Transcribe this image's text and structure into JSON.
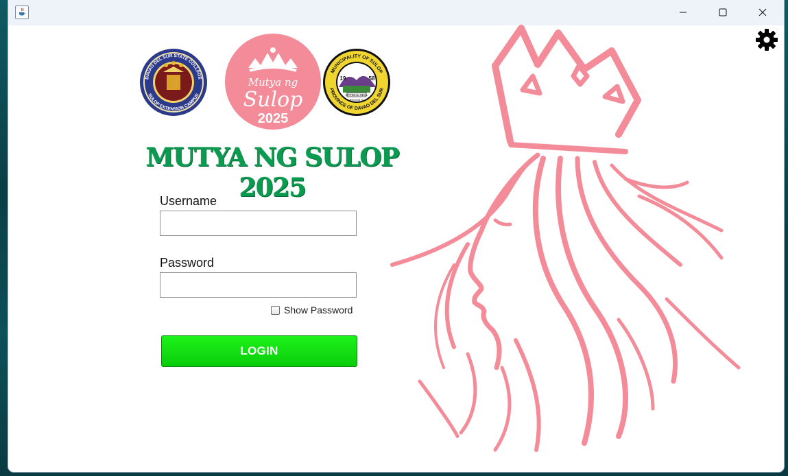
{
  "window": {
    "controls": {
      "minimize_icon": "minimize-icon",
      "maximize_icon": "maximize-icon",
      "close_icon": "close-icon"
    }
  },
  "settings": {
    "icon": "gear-icon"
  },
  "logos": {
    "left_seal": {
      "text_top": "DAVAO DEL SUR STATE COLLEGE",
      "text_bottom": "SULOP EXTENSION CAMPUS"
    },
    "center_badge": {
      "line1": "Mutya ng",
      "line2": "Sulop",
      "line3": "2025",
      "color": "#f48b99"
    },
    "right_seal": {
      "text_top": "MUNICIPALITY OF SULOP",
      "text_bottom": "PROVINCE OF DAVAO DEL SUR",
      "year_left": "19",
      "year_right": "58",
      "inner_label": "OFFICIAL SEAL",
      "region": "REGION XI"
    }
  },
  "header": {
    "title": "MUTYA NG SULOP 2025",
    "color": "#0a9b50"
  },
  "form": {
    "username_label": "Username",
    "username_value": "",
    "password_label": "Password",
    "password_value": "",
    "show_password_label": "Show Password",
    "show_password_checked": false,
    "login_label": "LOGIN",
    "login_color": "#12e012"
  },
  "illustration": {
    "name": "queen-silhouette",
    "color": "#f48b99"
  }
}
